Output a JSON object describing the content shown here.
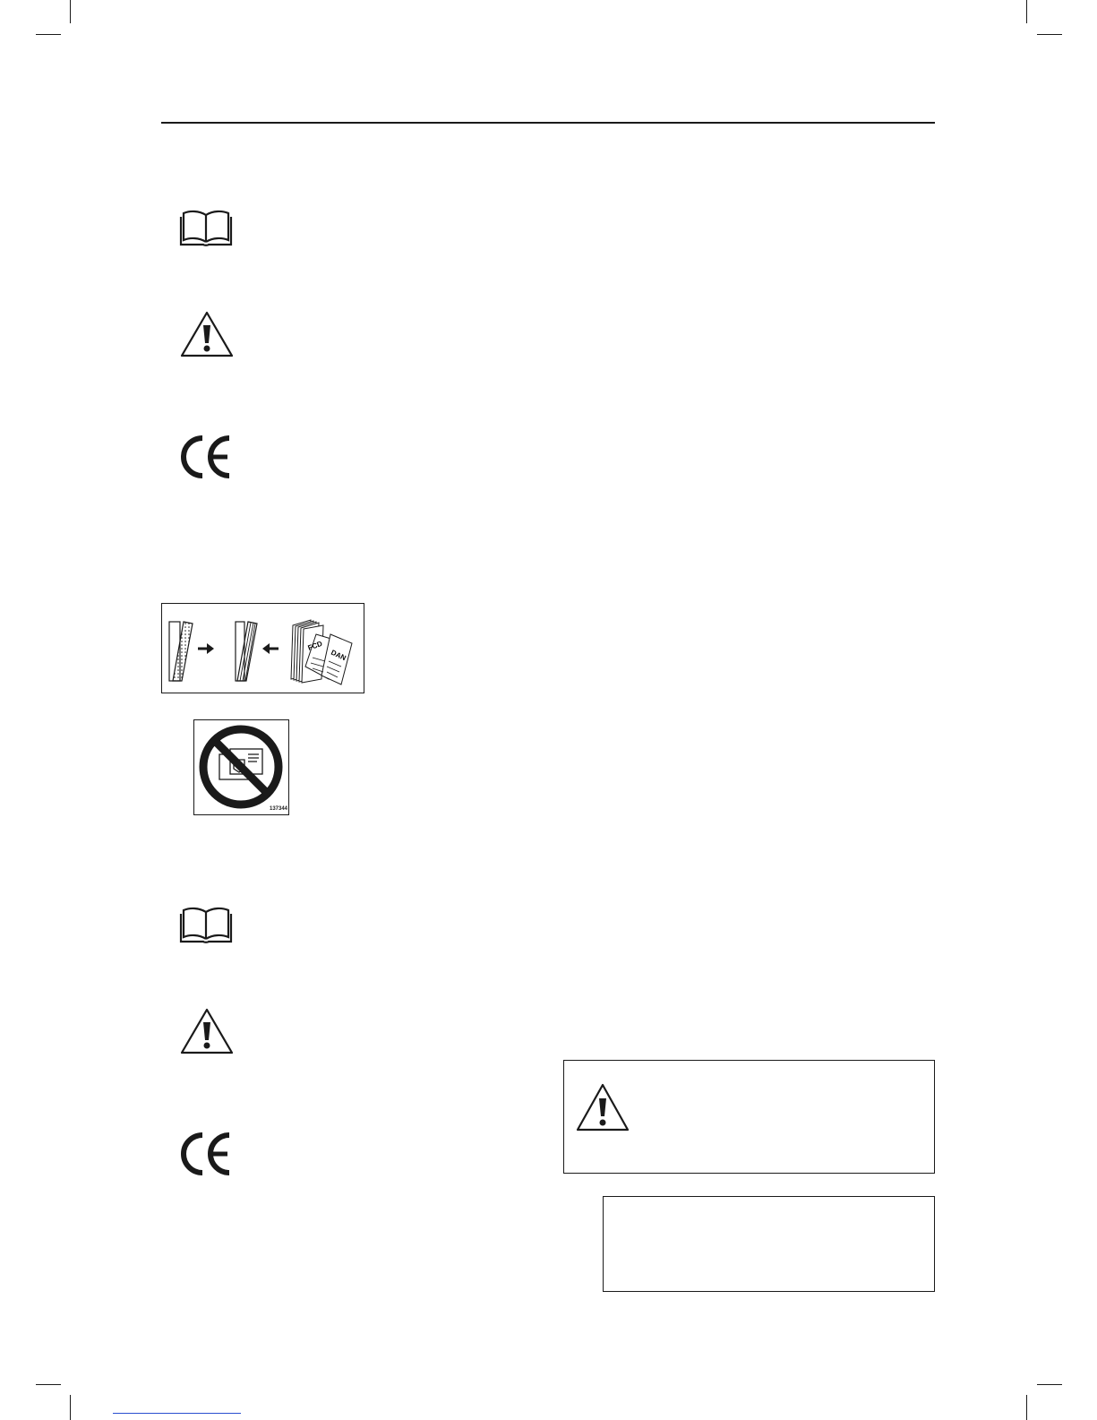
{
  "page": {
    "symbols": [
      {
        "icon": "book-icon",
        "meaning": "read-manual"
      },
      {
        "icon": "warning-triangle-icon",
        "meaning": "warning"
      },
      {
        "icon": "ce-mark-icon",
        "meaning": "ce-conformity"
      },
      {
        "icon": "book-icon",
        "meaning": "read-manual"
      },
      {
        "icon": "warning-triangle-icon",
        "meaning": "warning"
      },
      {
        "icon": "ce-mark-icon",
        "meaning": "ce-conformity"
      }
    ],
    "disposal_figure": {
      "label_1": "FCD",
      "label_2": "DAN"
    },
    "no_image_figure": {
      "code": "137344"
    },
    "warning_box": {
      "icon": "warning-triangle-icon",
      "text": ""
    },
    "note_box": {
      "text": ""
    }
  },
  "colors": {
    "ink": "#1a1a1a",
    "paper": "#ffffff",
    "link_underline": "#2a4fd0"
  }
}
